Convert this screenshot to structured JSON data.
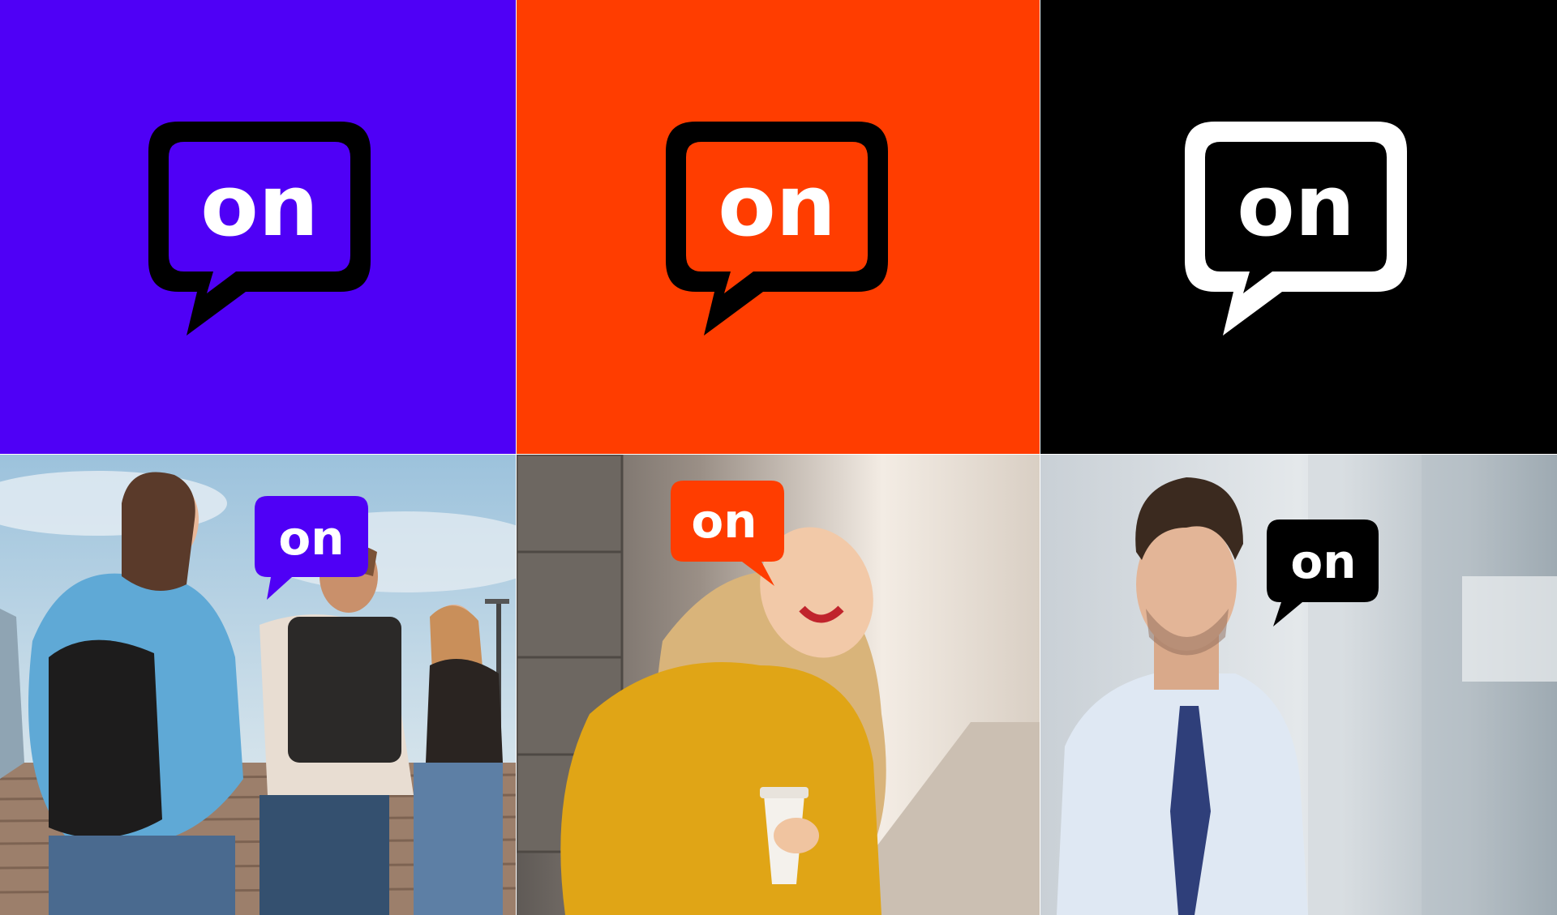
{
  "brand": {
    "wordmark": "on",
    "colors": {
      "purple": "#4F00F6",
      "orange": "#FF3D00",
      "black": "#000000",
      "white": "#FFFFFF"
    }
  },
  "tiles": [
    {
      "background": "purple",
      "bubble_fill": "purple",
      "bubble_outline": "black",
      "icon": "speech-bubble-icon"
    },
    {
      "background": "orange",
      "bubble_fill": "orange",
      "bubble_outline": "black",
      "icon": "speech-bubble-icon"
    },
    {
      "background": "black",
      "bubble_fill": "black",
      "bubble_outline": "white",
      "icon": "speech-bubble-icon"
    }
  ],
  "photos": [
    {
      "scene": "students walking up outdoor steps",
      "badge_color": "purple"
    },
    {
      "scene": "smiling woman in yellow hoodie holding coffee",
      "badge_color": "orange"
    },
    {
      "scene": "man in shirt and tie in office",
      "badge_color": "black"
    }
  ]
}
